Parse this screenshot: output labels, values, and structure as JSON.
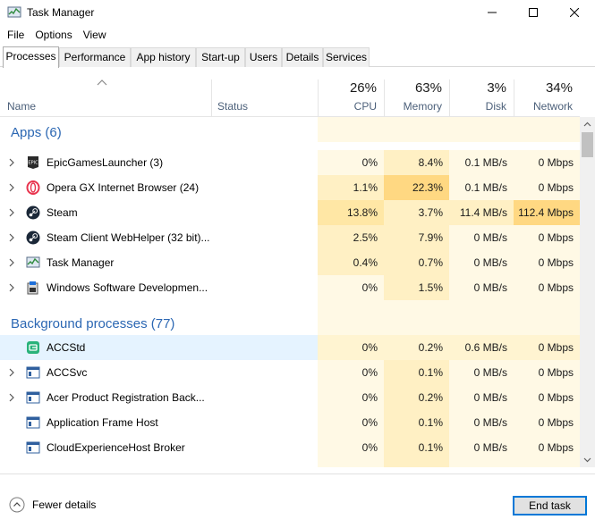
{
  "window": {
    "title": "Task Manager"
  },
  "menu": {
    "items": [
      {
        "label": "File"
      },
      {
        "label": "Options"
      },
      {
        "label": "View"
      }
    ]
  },
  "tabs": [
    {
      "label": "Processes",
      "active": true
    },
    {
      "label": "Performance"
    },
    {
      "label": "App history"
    },
    {
      "label": "Start-up"
    },
    {
      "label": "Users"
    },
    {
      "label": "Details"
    },
    {
      "label": "Services"
    }
  ],
  "columns": {
    "name": "Name",
    "status": "Status",
    "cpu": {
      "label": "CPU",
      "pct": "26%"
    },
    "memory": {
      "label": "Memory",
      "pct": "63%"
    },
    "disk": {
      "label": "Disk",
      "pct": "3%"
    },
    "network": {
      "label": "Network",
      "pct": "34%"
    }
  },
  "groups": {
    "apps": "Apps (6)",
    "background": "Background processes (77)"
  },
  "apps": [
    {
      "name": "EpicGamesLauncher (3)",
      "icon": "epic-games-icon",
      "cpu": "0%",
      "memory": "8.4%",
      "disk": "0.1 MB/s",
      "network": "0 Mbps"
    },
    {
      "name": "Opera GX Internet Browser (24)",
      "icon": "opera-gx-icon",
      "cpu": "1.1%",
      "memory": "22.3%",
      "disk": "0.1 MB/s",
      "network": "0 Mbps"
    },
    {
      "name": "Steam",
      "icon": "steam-icon",
      "cpu": "13.8%",
      "memory": "3.7%",
      "disk": "11.4 MB/s",
      "network": "112.4 Mbps"
    },
    {
      "name": "Steam Client WebHelper (32 bit)...",
      "icon": "steam-icon",
      "cpu": "2.5%",
      "memory": "7.9%",
      "disk": "0 MB/s",
      "network": "0 Mbps"
    },
    {
      "name": "Task Manager",
      "icon": "task-manager-icon",
      "cpu": "0.4%",
      "memory": "0.7%",
      "disk": "0 MB/s",
      "network": "0 Mbps"
    },
    {
      "name": "Windows Software Developmen...",
      "icon": "sdk-installer-icon",
      "cpu": "0%",
      "memory": "1.5%",
      "disk": "0 MB/s",
      "network": "0 Mbps"
    }
  ],
  "background": [
    {
      "name": "ACCStd",
      "icon": "acc-icon",
      "cpu": "0%",
      "memory": "0.2%",
      "disk": "0.6 MB/s",
      "network": "0 Mbps",
      "selected": true
    },
    {
      "name": "ACCSvc",
      "icon": "window-app-icon",
      "cpu": "0%",
      "memory": "0.1%",
      "disk": "0 MB/s",
      "network": "0 Mbps"
    },
    {
      "name": "Acer Product Registration Back...",
      "icon": "window-app-icon",
      "cpu": "0%",
      "memory": "0.2%",
      "disk": "0 MB/s",
      "network": "0 Mbps"
    },
    {
      "name": "Application Frame Host",
      "icon": "window-app-icon",
      "cpu": "0%",
      "memory": "0.1%",
      "disk": "0 MB/s",
      "network": "0 Mbps"
    },
    {
      "name": "CloudExperienceHost Broker",
      "icon": "window-app-icon",
      "cpu": "0%",
      "memory": "0.1%",
      "disk": "0 MB/s",
      "network": "0 Mbps"
    }
  ],
  "footer": {
    "fewer_details": "Fewer details",
    "end_task": "End task"
  },
  "colors": {
    "accent": "#0078d7",
    "group_title": "#2b67b3",
    "heat_low": "#fff9e5",
    "heat_mid": "#fff0c4",
    "heat_high": "#ffe7a5",
    "heat_max": "#ffd882",
    "selected_row": "#e5f3ff"
  }
}
